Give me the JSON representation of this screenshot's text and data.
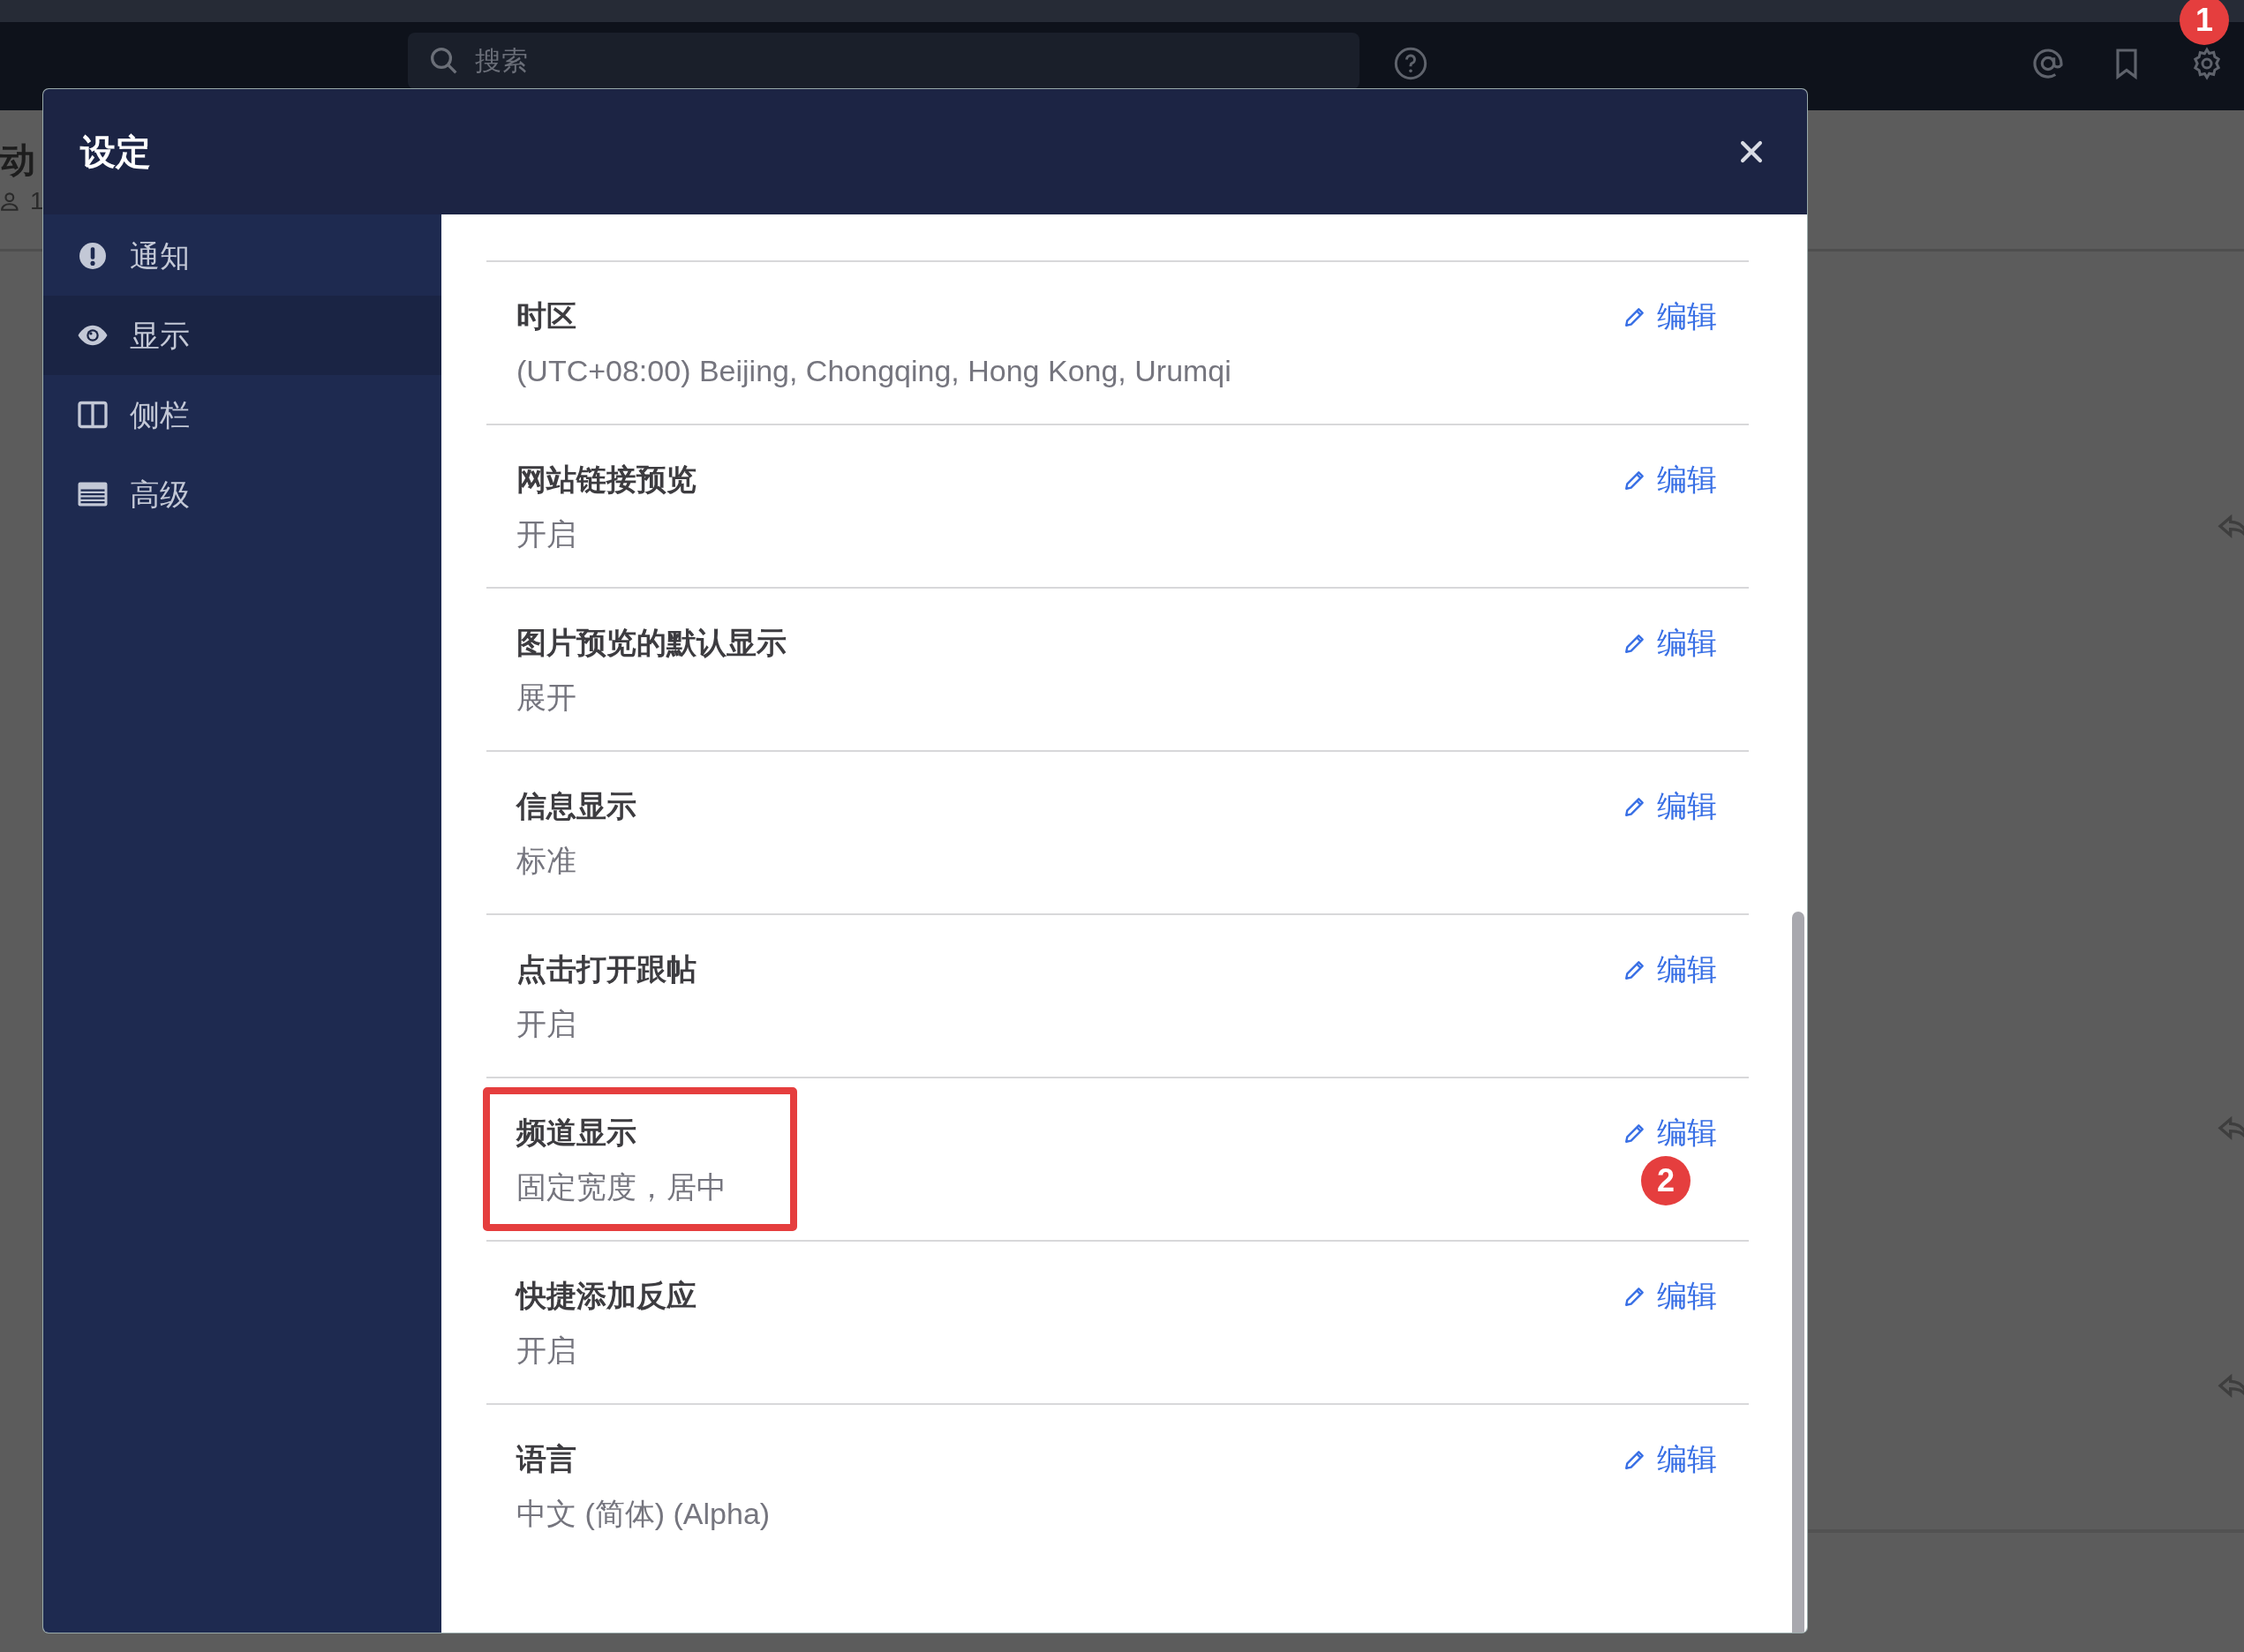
{
  "top_bar": {
    "search": {
      "placeholder": "搜索"
    },
    "callout": "1"
  },
  "background": {
    "channel_title": "动",
    "member_count": "1"
  },
  "modal": {
    "title": "设定",
    "sidebar": {
      "items": [
        {
          "label": "通知",
          "kind": "alert",
          "selected": false
        },
        {
          "label": "显示",
          "kind": "eye",
          "selected": true
        },
        {
          "label": "侧栏",
          "kind": "columns",
          "selected": false
        },
        {
          "label": "高级",
          "kind": "list",
          "selected": false
        }
      ]
    },
    "settings": [
      {
        "title": "时区",
        "value": "(UTC+08:00) Beijing, Chongqing, Hong Kong, Urumqi",
        "action": "编辑",
        "highlighted": false
      },
      {
        "title": "网站链接预览",
        "value": "开启",
        "action": "编辑",
        "highlighted": false
      },
      {
        "title": "图片预览的默认显示",
        "value": "展开",
        "action": "编辑",
        "highlighted": false
      },
      {
        "title": "信息显示",
        "value": "标准",
        "action": "编辑",
        "highlighted": false
      },
      {
        "title": "点击打开跟帖",
        "value": "开启",
        "action": "编辑",
        "highlighted": false
      },
      {
        "title": "频道显示",
        "value": "固定宽度，居中",
        "action": "编辑",
        "highlighted": true,
        "callout": "2"
      },
      {
        "title": "快捷添加反应",
        "value": "开启",
        "action": "编辑",
        "highlighted": false
      },
      {
        "title": "语言",
        "value": "中文 (简体) (Alpha)",
        "action": "编辑",
        "highlighted": false
      }
    ]
  }
}
